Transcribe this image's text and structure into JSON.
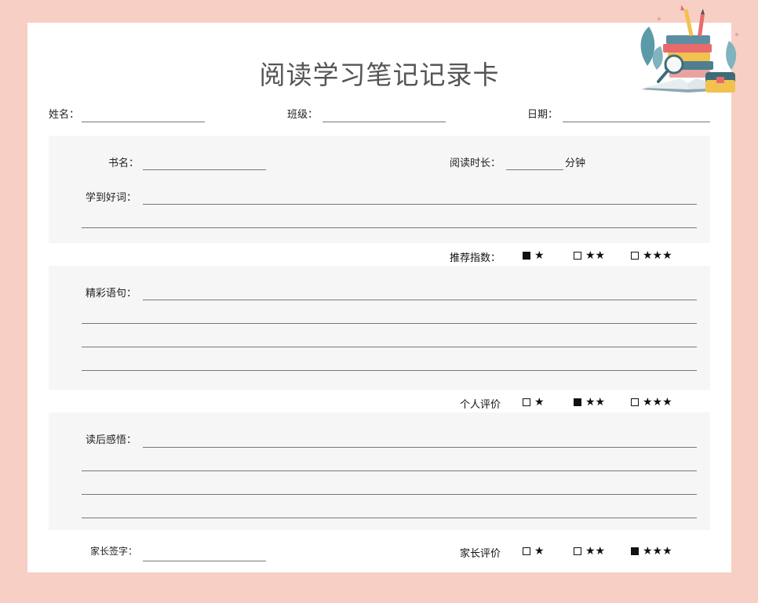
{
  "title": "阅读学习笔记记录卡",
  "header": {
    "name_label": "姓名：",
    "class_label": "班级：",
    "date_label": "日期："
  },
  "book": {
    "name_label": "书名：",
    "duration_label": "阅读时长：",
    "duration_unit": "分钟",
    "words_label": "学到好词："
  },
  "recommend": {
    "label": "推荐指数：",
    "options": [
      {
        "stars": "★",
        "checked": true
      },
      {
        "stars": "★★",
        "checked": false
      },
      {
        "stars": "★★★",
        "checked": false
      }
    ]
  },
  "sentences": {
    "label": "精彩语句："
  },
  "personal": {
    "label": "个人评价",
    "options": [
      {
        "stars": "★",
        "checked": false
      },
      {
        "stars": "★★",
        "checked": true
      },
      {
        "stars": "★★★",
        "checked": false
      }
    ]
  },
  "reflection": {
    "label": "读后感悟："
  },
  "parent": {
    "sign_label": "家长签字：",
    "eval_label": "家长评价",
    "options": [
      {
        "stars": "★",
        "checked": false
      },
      {
        "stars": "★★",
        "checked": false
      },
      {
        "stars": "★★★",
        "checked": true
      }
    ]
  },
  "colors": {
    "background": "#f7cfc4",
    "panel": "#f6f6f6",
    "card": "#ffffff"
  },
  "icons": [
    "books-magnifier-illustration"
  ]
}
